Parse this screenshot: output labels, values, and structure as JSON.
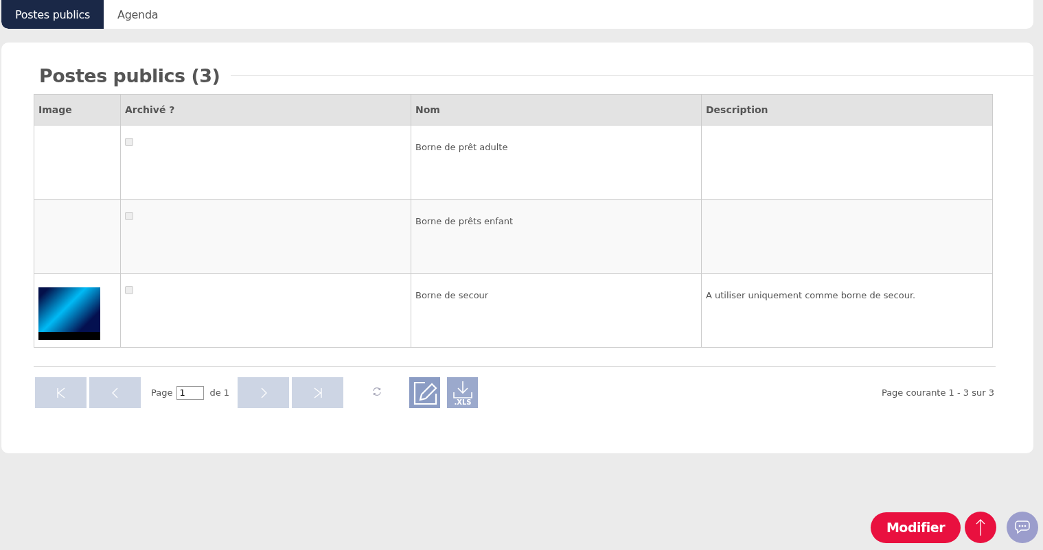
{
  "tabs": [
    {
      "label": "Postes publics",
      "selected": true
    },
    {
      "label": "Agenda",
      "selected": false
    }
  ],
  "panel": {
    "title": "Postes publics (3)"
  },
  "table": {
    "columns": [
      "Image",
      "Archivé ?",
      "Nom",
      "Description"
    ],
    "rows": [
      {
        "image": false,
        "archived": false,
        "name": "Borne de prêt adulte"
      },
      {
        "image": false,
        "archived": false,
        "name": "Borne de prêts enfant"
      },
      {
        "image": true,
        "archived": false,
        "name": "Borne de secour",
        "description": "A utiliser uniquement comme borne de secour."
      }
    ]
  },
  "pager": {
    "page_label": "Page",
    "page_value": "1",
    "of_label": "de 1",
    "export_label": ".XLS",
    "summary": "Page courante 1 - 3 sur 3"
  },
  "actions": {
    "primary": "Modifier"
  }
}
